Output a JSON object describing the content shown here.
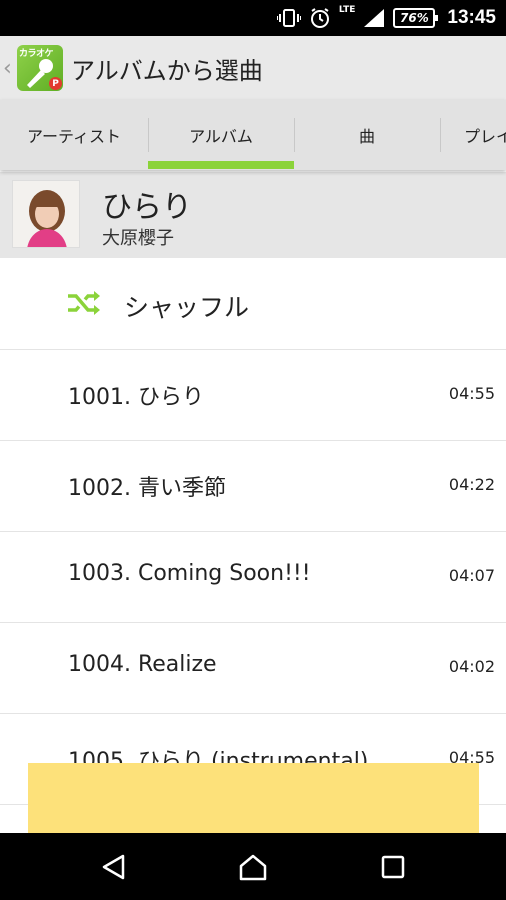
{
  "status_bar": {
    "lte": "LTE",
    "battery": "76%",
    "time": "13:45",
    "icons": [
      "vibrate-icon",
      "alarm-icon",
      "signal-icon",
      "battery-icon"
    ]
  },
  "app_bar": {
    "logo_text": "カラオケ",
    "logo_badge": "P",
    "title": "アルバムから選曲"
  },
  "tabs": [
    {
      "label": "アーティスト"
    },
    {
      "label": "アルバム",
      "selected": true
    },
    {
      "label": "曲"
    },
    {
      "label": "プレイ"
    }
  ],
  "album": {
    "title": "ひらり",
    "artist": "大原櫻子"
  },
  "shuffle": {
    "label": "シャッフル"
  },
  "tracks": [
    {
      "title": "1001. ひらり",
      "duration": "04:55"
    },
    {
      "title": "1002. 青い季節",
      "duration": "04:22"
    },
    {
      "title": "1003. Coming Soon!!!",
      "duration": "04:07"
    },
    {
      "title": "1004. Realize",
      "duration": "04:02"
    },
    {
      "title": "1005. ひらり (instrumental)",
      "duration": "04:55"
    }
  ],
  "colors": {
    "accent": "#8bd33a",
    "ad_banner": "#fde17a",
    "header_bg": "#e9e9e9"
  }
}
